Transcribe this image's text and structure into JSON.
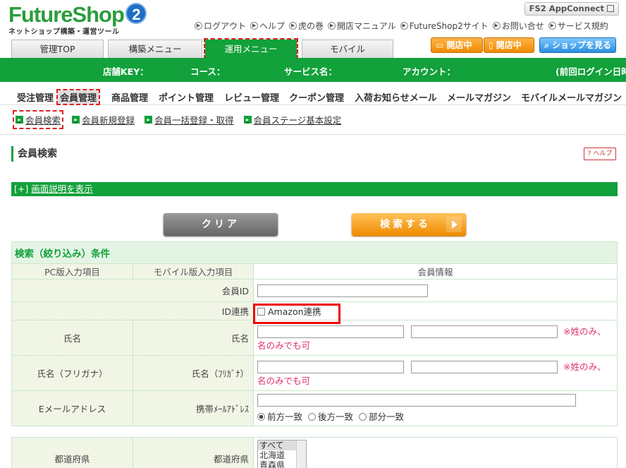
{
  "header": {
    "logo_text": "FutureShop",
    "logo_badge": "2",
    "logo_sub": "ネットショップ構築・運営ツール",
    "appconnect": "FS2 AppConnect",
    "links": [
      "ログアウト",
      "ヘルプ",
      "虎の巻",
      "開店マニュアル",
      "FutureShop2サイト",
      "お問い合せ",
      "サービス規約"
    ]
  },
  "tabs": [
    "管理TOP",
    "構築メニュー",
    "運用メニュー",
    "モバイル"
  ],
  "status_buttons": {
    "pc": "開店中",
    "mobile": "開店中",
    "shop": "ショップを見る"
  },
  "infobar": {
    "shop_key": "店舗KEY：",
    "course": "コース：",
    "service": "サービス名：",
    "account": "アカウント：",
    "last_login": "(前回ログイン日時"
  },
  "submenu": [
    "受注管理",
    "会員管理",
    "商品管理",
    "ポイント管理",
    "レビュー管理",
    "クーポン管理",
    "入荷お知らせメール",
    "メールマガジン",
    "モバイルメールマガジン"
  ],
  "subsubmenu": [
    "会員検索",
    "会員新規登録",
    "会員一括登録・取得",
    "会員ステージ基本設定"
  ],
  "page": {
    "title": "会員検索",
    "help": "ヘルプ",
    "explain_prefix": "[+]",
    "explain_link": "画面説明を表示"
  },
  "buttons": {
    "clear": "クリア",
    "search": "検索する"
  },
  "form": {
    "heading": "検索（絞り込み）条件",
    "col_pc": "PC版入力項目",
    "col_mobile": "モバイル版入力項目",
    "col_info": "会員情報",
    "member_id": "会員ID",
    "id_link": "ID連携",
    "amazon": "Amazon連携",
    "name_pc": "氏名",
    "name_mobile": "氏名",
    "name_note1": "※姓のみ、",
    "name_note2": "名のみでも可",
    "kana_pc": "氏名（フリガナ）",
    "kana_mobile": "氏名（ﾌﾘｶﾞﾅ）",
    "kana_note1": "※姓のみ、",
    "kana_note2": "名のみでも可",
    "email_pc": "Eメールアドレス",
    "email_mobile": "携帯ﾒｰﾙｱﾄﾞﾚｽ",
    "match_options": [
      "前方一致",
      "後方一致",
      "部分一致"
    ],
    "pref_pc": "都道府県",
    "pref_mobile": "都道府県",
    "pref_options": [
      "すべて",
      "北海道",
      "青森県"
    ]
  }
}
